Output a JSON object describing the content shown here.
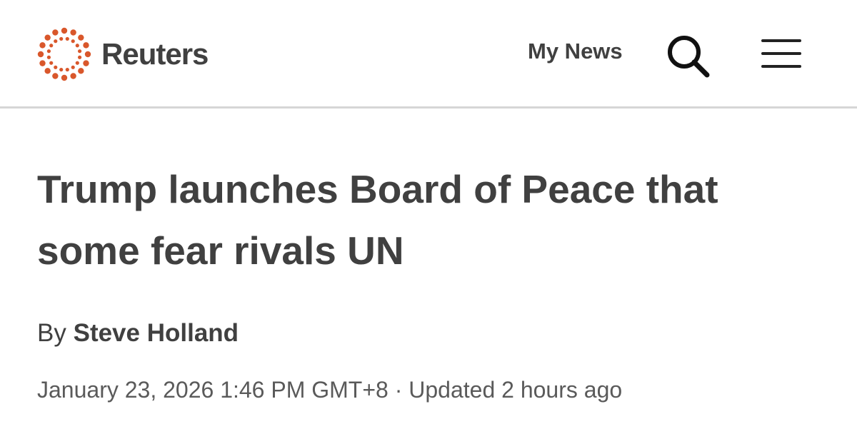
{
  "header": {
    "brand_name": "Reuters",
    "brand_color": "#d9572b",
    "my_news_label": "My News",
    "search_icon": "search-icon",
    "menu_icon": "hamburger-menu-icon"
  },
  "article": {
    "headline": "Trump launches Board of Peace that some fear rivals UN",
    "byline_prefix": "By",
    "author": "Steve Holland",
    "published": "January 23, 2026 1:46 PM GMT+8",
    "separator": "·",
    "updated": "Updated 2 hours ago"
  },
  "colors": {
    "text": "#404040",
    "divider": "#d6d6d6"
  }
}
